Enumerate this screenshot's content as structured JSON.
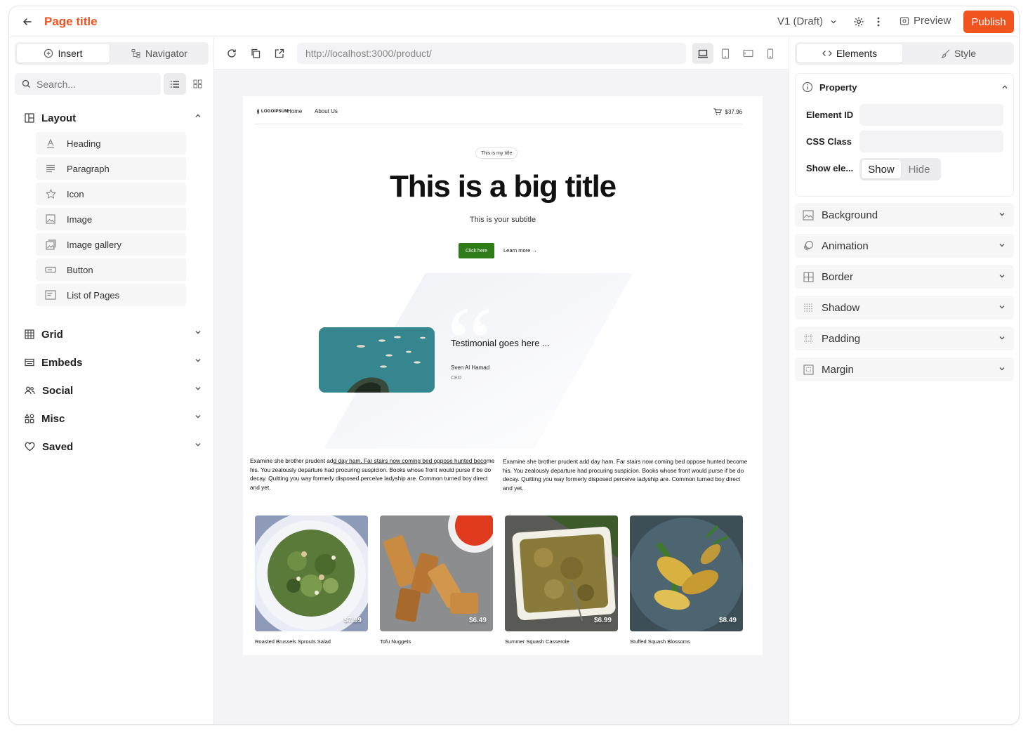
{
  "topbar": {
    "title": "Page title",
    "version": "V1 (Draft)",
    "preview_label": "Preview",
    "publish_label": "Publish"
  },
  "left": {
    "tabs": [
      {
        "label": "Insert",
        "icon": "plus-circle-icon",
        "active": true
      },
      {
        "label": "Navigator",
        "icon": "tree-icon",
        "active": false
      }
    ],
    "search": {
      "placeholder": "Search..."
    },
    "sections": [
      {
        "label": "Layout",
        "icon": "layout-icon",
        "expanded": true,
        "items": [
          {
            "label": "Heading",
            "icon": "heading-icon"
          },
          {
            "label": "Paragraph",
            "icon": "paragraph-icon"
          },
          {
            "label": "Icon",
            "icon": "star-icon"
          },
          {
            "label": "Image",
            "icon": "image-icon"
          },
          {
            "label": "Image gallery",
            "icon": "gallery-icon"
          },
          {
            "label": "Button",
            "icon": "button-icon"
          },
          {
            "label": "List of Pages",
            "icon": "pages-icon"
          }
        ]
      },
      {
        "label": "Grid",
        "icon": "grid-icon",
        "expanded": false
      },
      {
        "label": "Embeds",
        "icon": "embeds-icon",
        "expanded": false
      },
      {
        "label": "Social",
        "icon": "users-icon",
        "expanded": false
      },
      {
        "label": "Misc",
        "icon": "shapes-icon",
        "expanded": false
      },
      {
        "label": "Saved",
        "icon": "heart-icon",
        "expanded": false
      }
    ]
  },
  "center": {
    "url": "http://localhost:3000/product/",
    "site": {
      "logo": "LOGOIPSUM",
      "nav": [
        "Home",
        "About Us"
      ],
      "cart_total": "$37.96",
      "pill": "This is my title",
      "title": "This is a big title",
      "subtitle": "This is your subtitle",
      "cta": "Click here",
      "learn_more": "Learn more →",
      "testimonial": {
        "quote": "Testimonial goes here ...",
        "name": "Sven Al Hamad",
        "role": "CEO"
      },
      "para_left_1": "Examine she brother prudent ad",
      "para_left_u": "d day ham. Far stairs now coming bed oppose hunted beco",
      "para_left_2": "me his. You zealously departure had procuring suspicion. Books whose front would purse if be do decay. Quitting you way formerly disposed perceive ladyship are. Common turned boy direct and yet.",
      "para_right": "Examine she brother prudent add day ham. Far stairs now coming bed oppose hunted become his. You zealously departure had procuring suspicion. Books whose front would purse if be do decay. Quitting you way formerly disposed perceive ladyship are. Common turned boy direct and yet.",
      "products": [
        {
          "name": "Roasted Brussels Sprouts Salad",
          "price": "$7.99"
        },
        {
          "name": "Tofu Nuggets",
          "price": "$6.49"
        },
        {
          "name": "Summer Squash Casserole",
          "price": "$6.99"
        },
        {
          "name": "Stuffed Squash Blossoms",
          "price": "$8.49"
        }
      ]
    }
  },
  "right": {
    "tabs": [
      {
        "label": "Elements",
        "icon": "code-icon",
        "active": true
      },
      {
        "label": "Style",
        "icon": "brush-icon",
        "active": false
      }
    ],
    "property": {
      "title": "Property",
      "element_id_label": "Element ID",
      "css_class_label": "CSS Class",
      "show_label": "Show ele...",
      "show": "Show",
      "hide": "Hide"
    },
    "accordions": [
      {
        "label": "Background",
        "icon": "background-icon"
      },
      {
        "label": "Animation",
        "icon": "animation-icon"
      },
      {
        "label": "Border",
        "icon": "border-icon"
      },
      {
        "label": "Shadow",
        "icon": "shadow-icon"
      },
      {
        "label": "Padding",
        "icon": "padding-icon"
      },
      {
        "label": "Margin",
        "icon": "margin-icon"
      }
    ]
  },
  "colors": {
    "accent": "#f2541f",
    "cta_green": "#2f7d1a"
  }
}
